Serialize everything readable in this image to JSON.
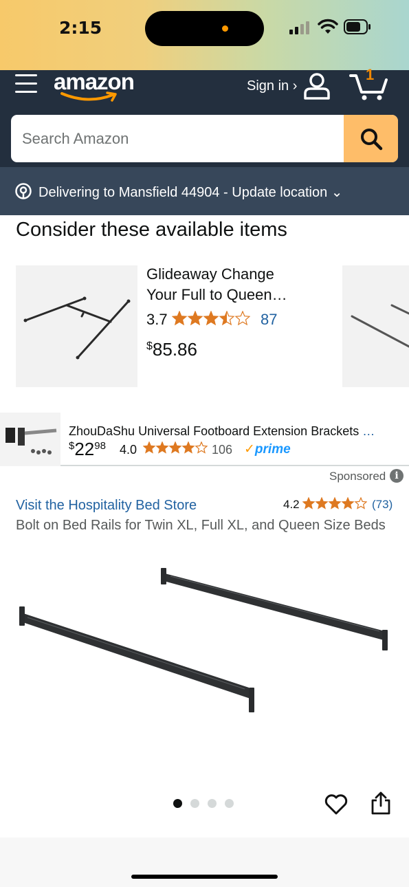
{
  "status_bar": {
    "time": "2:15"
  },
  "header": {
    "logo_text": "amazon",
    "sign_in": "Sign in ›",
    "cart_count": "1"
  },
  "search": {
    "placeholder": "Search Amazon"
  },
  "delivery": {
    "text": "Delivering to Mansfield 44904 - Update location ⌄"
  },
  "consider": {
    "title": "Consider these available items",
    "item": {
      "title_line1": "Glideaway Change",
      "title_line2": "Your Full to Queen…",
      "rating": "3.7",
      "rating_value": 3.5,
      "review_count": "87",
      "currency": "$",
      "price": "85.86"
    }
  },
  "sponsored_strip": {
    "title": "ZhouDaShu Universal Footboard Extension Brackets",
    "ellipsis": "…",
    "currency": "$",
    "price_whole": "22",
    "price_fraction": "98",
    "rating": "4.0",
    "rating_value": 4,
    "review_count": "106",
    "prime_label": "prime",
    "prime_check": "✓"
  },
  "sponsored_label": "Sponsored",
  "info_glyph": "i",
  "product": {
    "store_link": "Visit the Hospitality Bed Store",
    "rating": "4.2",
    "rating_value": 4,
    "review_count": "(73)",
    "title": "Bolt on Bed Rails for Twin XL, Full XL, and Queen Size Beds",
    "image_count": 4,
    "active_image": 1
  },
  "colors": {
    "header_bg": "#232f3e",
    "delivery_bg": "#37475a",
    "search_button": "#febd69",
    "star": "#de7921",
    "link": "#2162a1",
    "cart_count": "#f08804",
    "prime": "#1a98ff"
  }
}
